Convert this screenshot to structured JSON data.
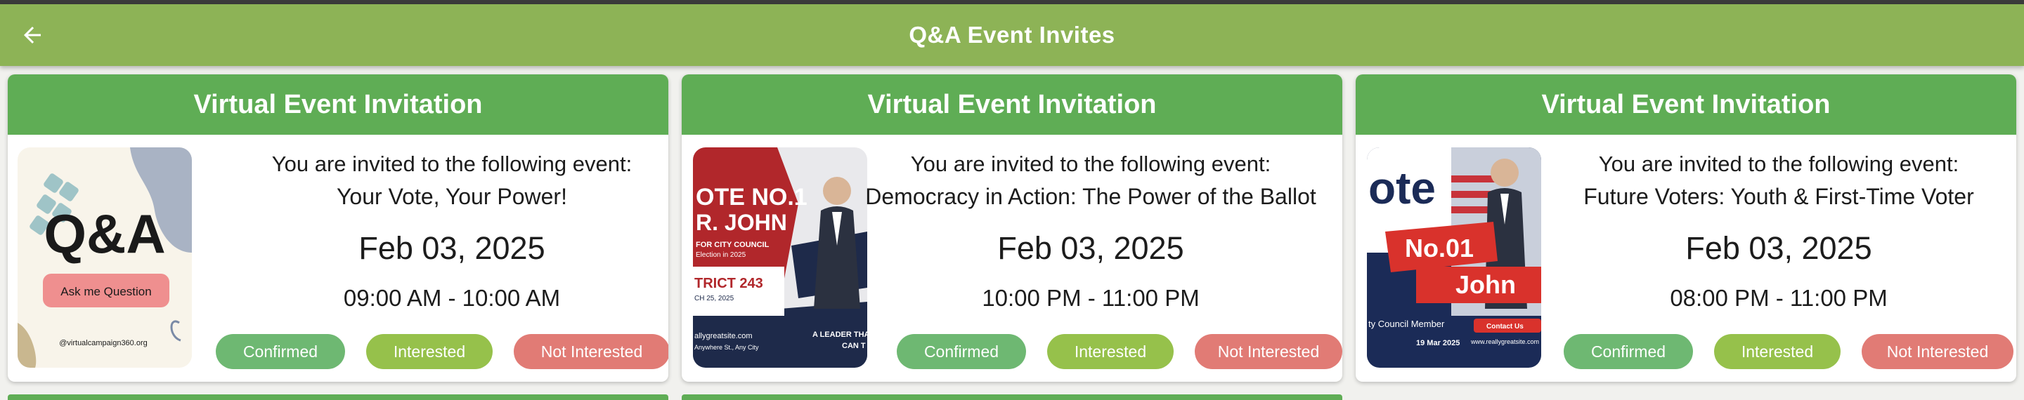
{
  "app_bar": {
    "title": "Q&A Event Invites",
    "background": "#8db356",
    "back_icon": "arrow-left-icon"
  },
  "cards": [
    {
      "header": "Virtual Event Invitation",
      "invite_line": "You are invited to the following event:",
      "event_name": "Your Vote, Your Power!",
      "date": "Feb 03, 2025",
      "time": "09:00 AM - 10:00 AM",
      "poster": {
        "big_text": "Q&A",
        "pill": "Ask me Question",
        "handle": "@virtualcampaign360.org"
      },
      "buttons": {
        "confirmed": "Confirmed",
        "interested": "Interested",
        "not_interested": "Not Interested"
      }
    },
    {
      "header": "Virtual Event Invitation",
      "invite_line": "You are invited to the following event:",
      "event_name": "Democracy in Action: The Power of the Ballot",
      "date": "Feb 03, 2025",
      "time": "10:00 PM - 11:00 PM",
      "poster": {
        "line1": "OTE NO.1",
        "line2": "R. JOHN",
        "line3": "FOR CITY COUNCIL",
        "line4": "Election in 2025",
        "line5": "TRICT 243",
        "line6": "CH 25, 2025",
        "line7": "allygreatsite.com",
        "line8": "Anywhere St., Any City",
        "slogan1": "A LEADER THA",
        "slogan2": "CAN T"
      },
      "buttons": {
        "confirmed": "Confirmed",
        "interested": "Interested",
        "not_interested": "Not Interested"
      }
    },
    {
      "header": "Virtual Event Invitation",
      "invite_line": "You are invited to the following event:",
      "event_name": "Future Voters: Youth & First-Time Voter",
      "date": "Feb 03, 2025",
      "time": "08:00 PM - 11:00 PM",
      "poster": {
        "line1": "ote",
        "line2": "No.01",
        "line3": "John",
        "line4": "Contact Us",
        "line5": "ty Council Member",
        "line6": "19 Mar 2025",
        "line7": "www.reallygreatsite.com"
      },
      "buttons": {
        "confirmed": "Confirmed",
        "interested": "Interested",
        "not_interested": "Not Interested"
      }
    }
  ],
  "colors": {
    "card_header": "#5fad55",
    "confirmed": "#6eb872",
    "interested": "#96c14b",
    "not_interested": "#e17b75"
  }
}
